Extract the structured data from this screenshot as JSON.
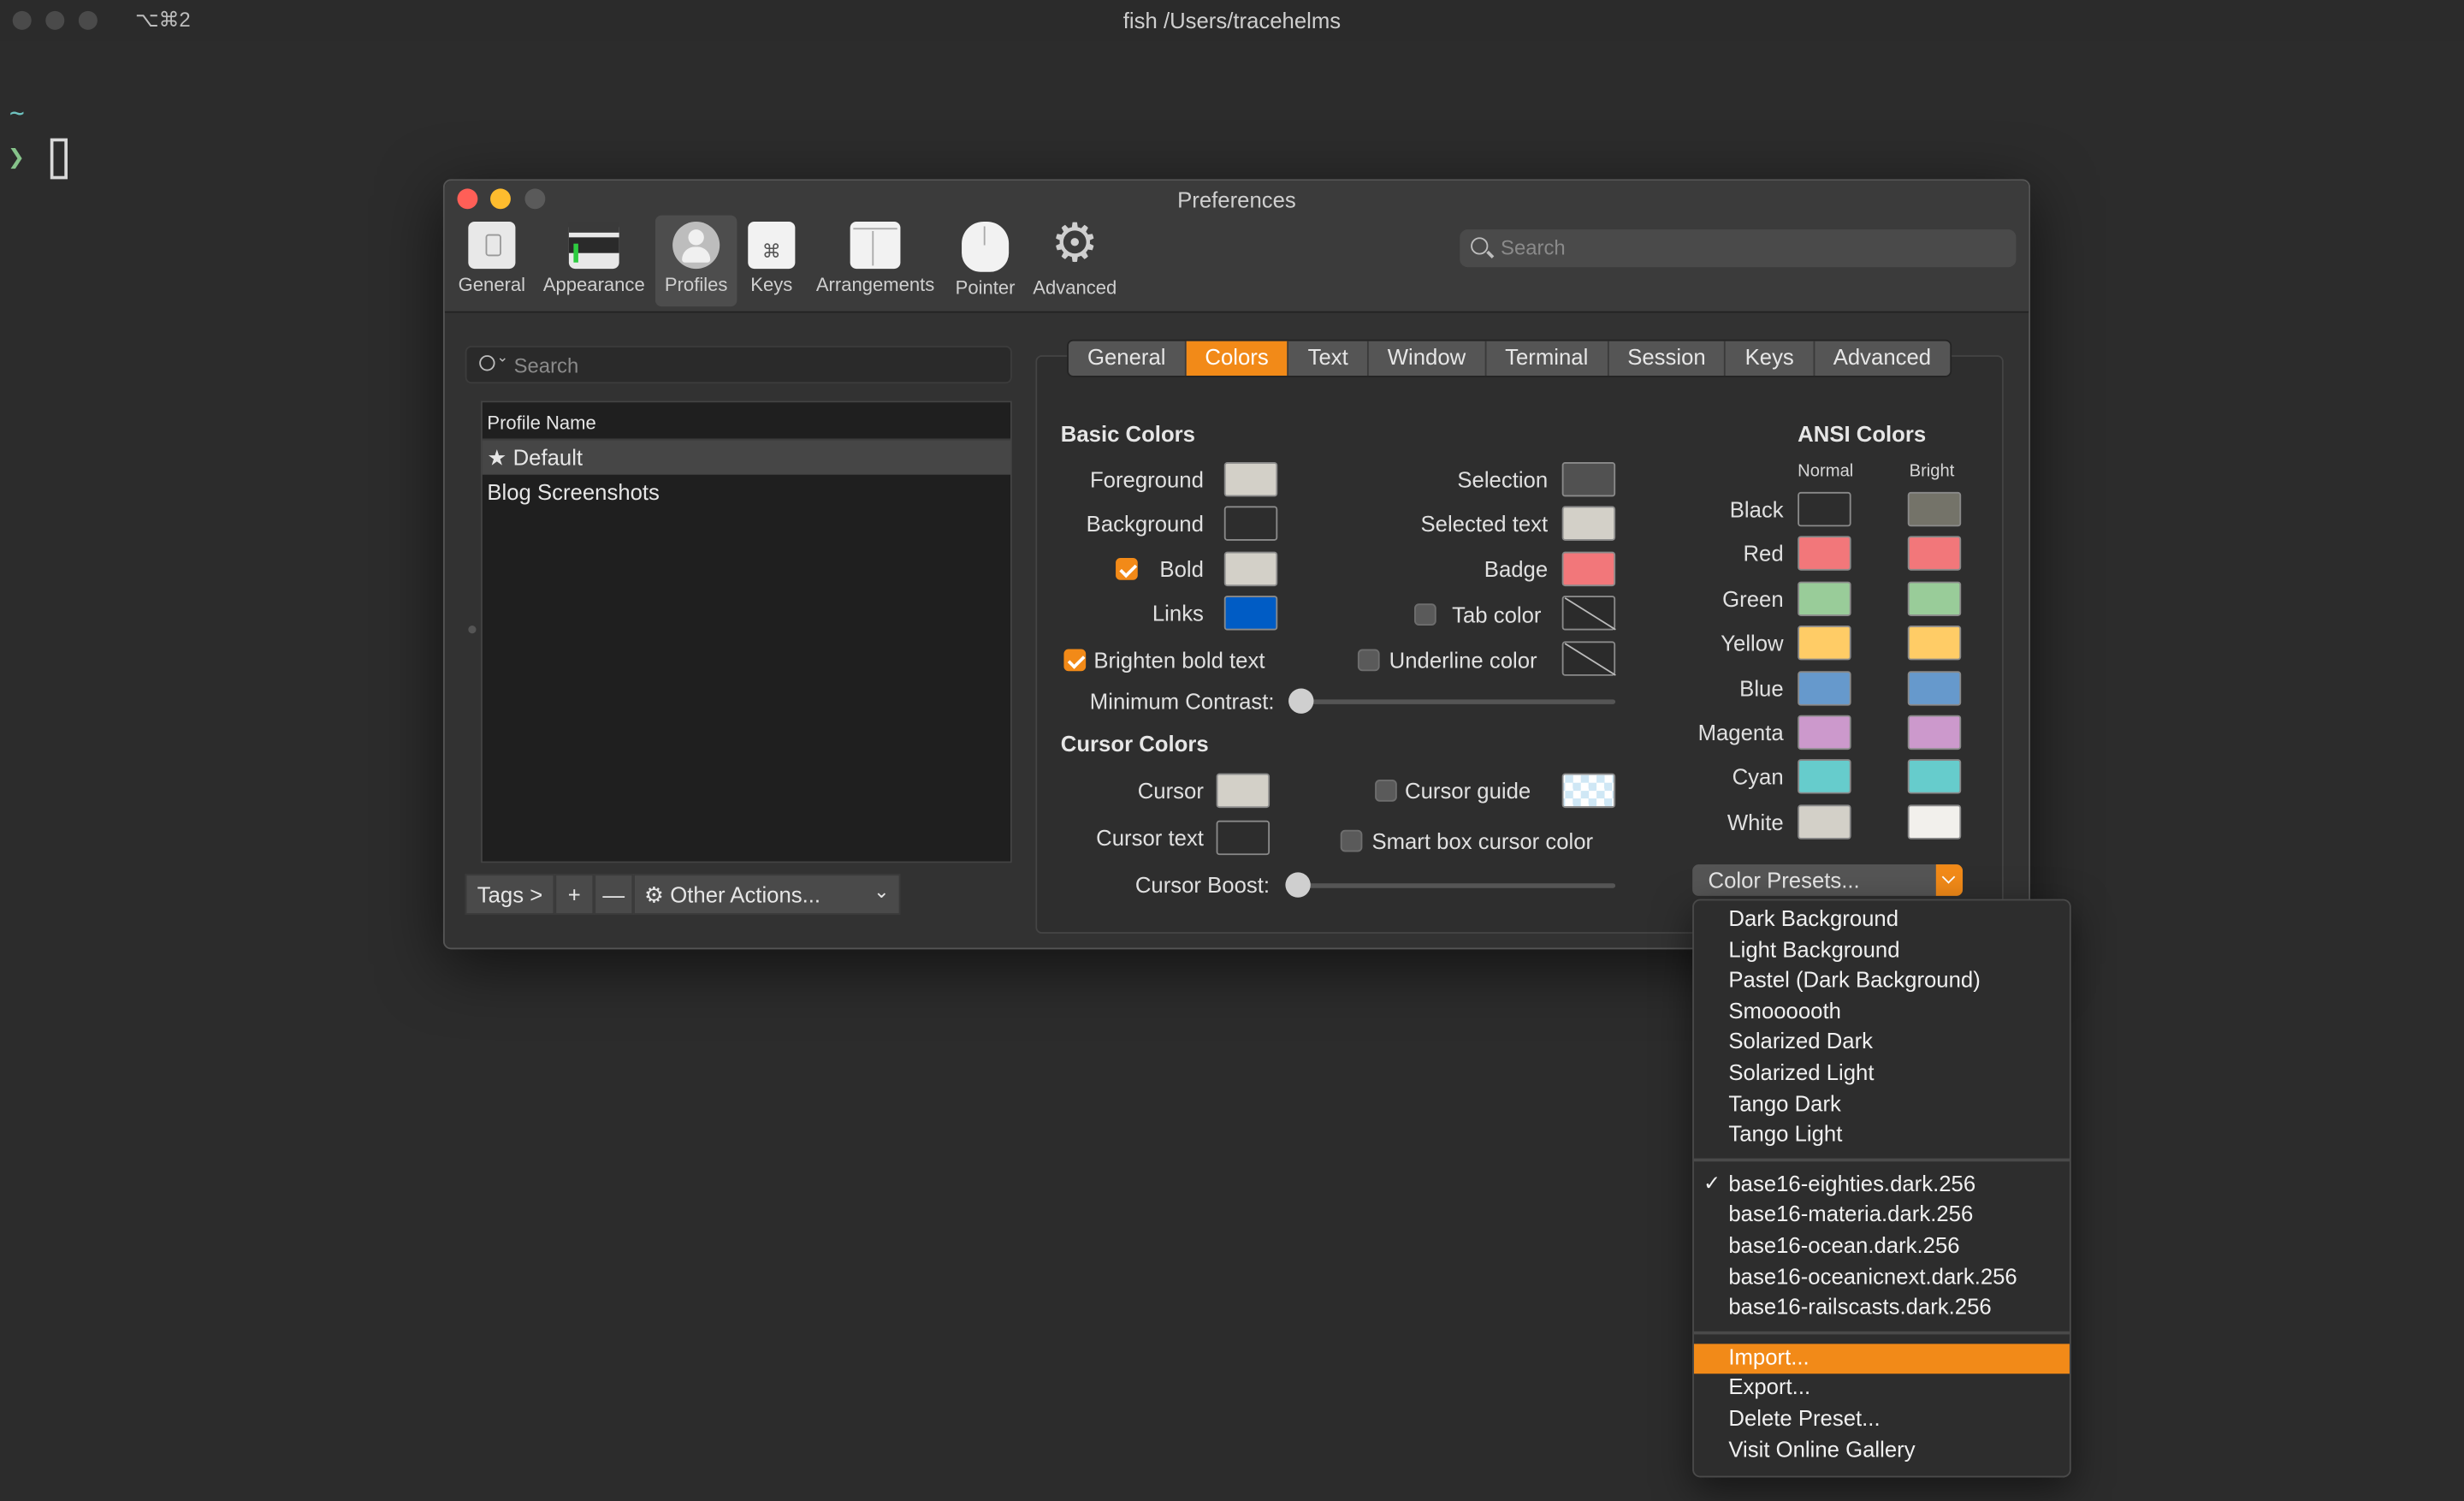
{
  "terminal": {
    "shortcut": "⌥⌘2",
    "title": "fish /Users/tracehelms",
    "tilde": "~",
    "prompt": "❯"
  },
  "prefs": {
    "title": "Preferences",
    "toolbar": [
      "General",
      "Appearance",
      "Profiles",
      "Keys",
      "Arrangements",
      "Pointer",
      "Advanced"
    ],
    "search_placeholder": "Search",
    "left_search_placeholder": "Search",
    "profile_header": "Profile Name",
    "profiles": [
      "Default",
      "Blog Screenshots"
    ],
    "tags_label": "Tags >",
    "add_label": "+",
    "remove_label": "—",
    "other_actions": "Other Actions...",
    "tabs": [
      "General",
      "Colors",
      "Text",
      "Window",
      "Terminal",
      "Session",
      "Keys",
      "Advanced"
    ],
    "active_tab": "Colors",
    "basic": {
      "heading": "Basic Colors",
      "foreground": "Foreground",
      "background": "Background",
      "bold": "Bold",
      "links": "Links",
      "selection": "Selection",
      "selected_text": "Selected text",
      "badge": "Badge",
      "tab_color": "Tab color",
      "brighten_bold": "Brighten bold text",
      "underline_color": "Underline color",
      "min_contrast": "Minimum Contrast:"
    },
    "cursor": {
      "heading": "Cursor Colors",
      "cursor": "Cursor",
      "cursor_text": "Cursor text",
      "cursor_guide": "Cursor guide",
      "smart_box": "Smart box cursor color",
      "boost": "Cursor Boost:"
    },
    "ansi": {
      "heading": "ANSI Colors",
      "normal": "Normal",
      "bright": "Bright",
      "rows": [
        {
          "name": "Black",
          "normal": "#2d2d2d",
          "bright": "#747369"
        },
        {
          "name": "Red",
          "normal": "#f2777a",
          "bright": "#f2777a"
        },
        {
          "name": "Green",
          "normal": "#99cc99",
          "bright": "#99cc99"
        },
        {
          "name": "Yellow",
          "normal": "#ffcc66",
          "bright": "#ffcc66"
        },
        {
          "name": "Blue",
          "normal": "#6699cc",
          "bright": "#6699cc"
        },
        {
          "name": "Magenta",
          "normal": "#cc99cc",
          "bright": "#cc99cc"
        },
        {
          "name": "Cyan",
          "normal": "#66cccc",
          "bright": "#66cccc"
        },
        {
          "name": "White",
          "normal": "#d3d0c8",
          "bright": "#f2f0ec"
        }
      ]
    },
    "color_presets": "Color Presets..."
  },
  "menu": {
    "group1": [
      "Dark Background",
      "Light Background",
      "Pastel (Dark Background)",
      "Smoooooth",
      "Solarized Dark",
      "Solarized Light",
      "Tango Dark",
      "Tango Light"
    ],
    "group2": [
      "base16-eighties.dark.256",
      "base16-materia.dark.256",
      "base16-ocean.dark.256",
      "base16-oceanicnext.dark.256",
      "base16-railscasts.dark.256"
    ],
    "checked": "base16-eighties.dark.256",
    "group3": [
      "Import...",
      "Export...",
      "Delete Preset...",
      "Visit Online Gallery"
    ],
    "highlighted": "Import..."
  },
  "colors": {
    "accent": "#f28a18",
    "foreground": "#d3d0c8",
    "background": "#2d2d2d",
    "bold": "#d3d0c8",
    "links": "#005cc5",
    "selection": "#515151",
    "selected_text": "#d3d0c8",
    "badge": "#f2777a",
    "cursor": "#d3d0c8",
    "cursor_text": "#2d2d2d"
  }
}
